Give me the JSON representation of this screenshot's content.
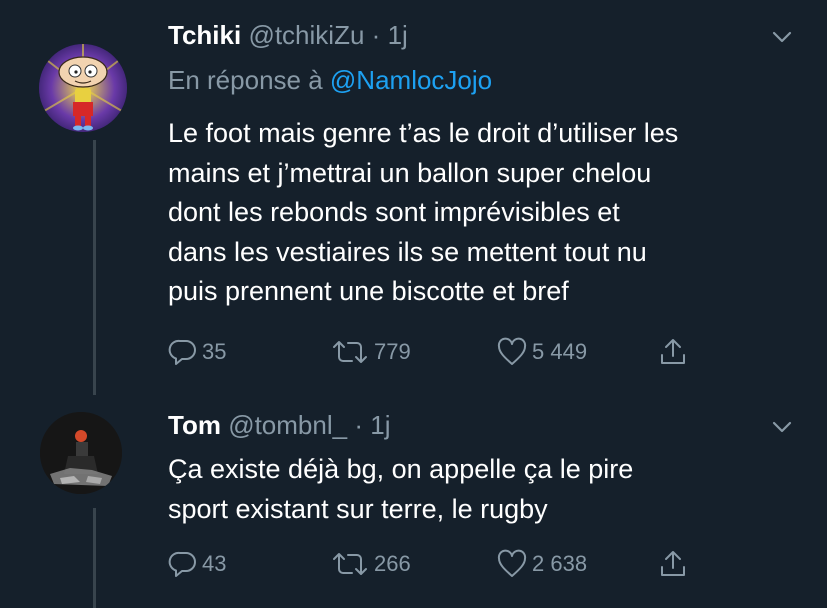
{
  "theme": {
    "background": "#15202b",
    "text": "#ffffff",
    "muted": "#8899a6",
    "link": "#1da1f2",
    "thread_line": "#38444d"
  },
  "tweets": [
    {
      "display_name": "Tchiki",
      "handle": "@tchikiZu",
      "separator": "·",
      "time": "1j",
      "reply_prefix": "En réponse à",
      "reply_mention": "@NamlocJojo",
      "text": "Le foot mais genre t’as le droit d’utiliser les\nmains et j’mettrai un ballon super chelou\ndont les rebonds sont imprévisibles et\ndans les vestiaires ils se mettent tout nu\npuis prennent une biscotte et bref",
      "replies": "35",
      "retweets": "779",
      "likes": "5 449",
      "icons": [
        "reply-icon",
        "retweet-icon",
        "like-icon",
        "share-icon",
        "chevron-down-icon"
      ]
    },
    {
      "display_name": "Tom",
      "handle": "@tombnl_",
      "separator": "·",
      "time": "1j",
      "text": "Ça existe déjà bg, on appelle ça le pire\nsport existant sur terre, le rugby",
      "replies": "43",
      "retweets": "266",
      "likes": "2 638",
      "icons": [
        "reply-icon",
        "retweet-icon",
        "like-icon",
        "share-icon",
        "chevron-down-icon"
      ]
    }
  ]
}
